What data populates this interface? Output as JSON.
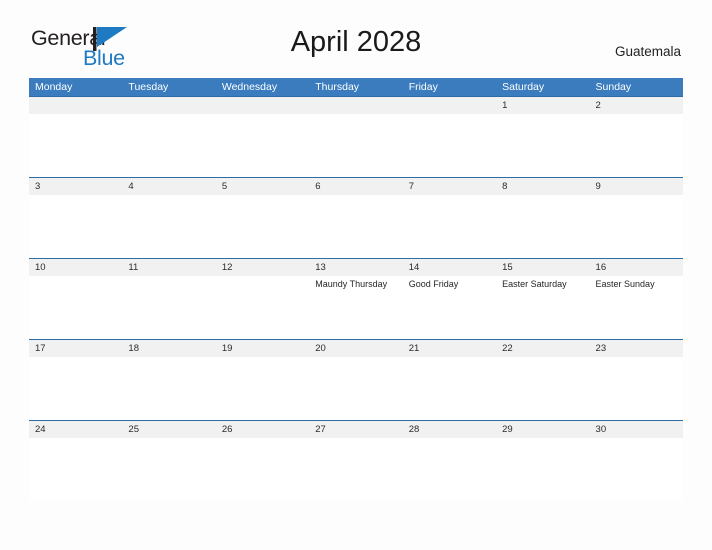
{
  "logo": {
    "word1": "General",
    "word2": "Blue",
    "flag_icon": "blue-flag-triangle-icon",
    "color_dark": "#231f20",
    "color_blue": "#1f7ac4"
  },
  "header": {
    "title": "April 2028",
    "country": "Guatemala"
  },
  "theme": {
    "header_bg": "#3a7cbe",
    "header_text": "#ffffff",
    "date_strip_bg": "#f1f1f1",
    "week_rule": "#2e6da4",
    "page_bg": "#fdfdfe"
  },
  "calendar": {
    "weekdays": [
      "Monday",
      "Tuesday",
      "Wednesday",
      "Thursday",
      "Friday",
      "Saturday",
      "Sunday"
    ],
    "weeks": [
      {
        "days": [
          {
            "num": "",
            "events": []
          },
          {
            "num": "",
            "events": []
          },
          {
            "num": "",
            "events": []
          },
          {
            "num": "",
            "events": []
          },
          {
            "num": "",
            "events": []
          },
          {
            "num": "1",
            "events": []
          },
          {
            "num": "2",
            "events": []
          }
        ]
      },
      {
        "days": [
          {
            "num": "3",
            "events": []
          },
          {
            "num": "4",
            "events": []
          },
          {
            "num": "5",
            "events": []
          },
          {
            "num": "6",
            "events": []
          },
          {
            "num": "7",
            "events": []
          },
          {
            "num": "8",
            "events": []
          },
          {
            "num": "9",
            "events": []
          }
        ]
      },
      {
        "days": [
          {
            "num": "10",
            "events": []
          },
          {
            "num": "11",
            "events": []
          },
          {
            "num": "12",
            "events": []
          },
          {
            "num": "13",
            "events": [
              "Maundy Thursday"
            ]
          },
          {
            "num": "14",
            "events": [
              "Good Friday"
            ]
          },
          {
            "num": "15",
            "events": [
              "Easter Saturday"
            ]
          },
          {
            "num": "16",
            "events": [
              "Easter Sunday"
            ]
          }
        ]
      },
      {
        "days": [
          {
            "num": "17",
            "events": []
          },
          {
            "num": "18",
            "events": []
          },
          {
            "num": "19",
            "events": []
          },
          {
            "num": "20",
            "events": []
          },
          {
            "num": "21",
            "events": []
          },
          {
            "num": "22",
            "events": []
          },
          {
            "num": "23",
            "events": []
          }
        ]
      },
      {
        "days": [
          {
            "num": "24",
            "events": []
          },
          {
            "num": "25",
            "events": []
          },
          {
            "num": "26",
            "events": []
          },
          {
            "num": "27",
            "events": []
          },
          {
            "num": "28",
            "events": []
          },
          {
            "num": "29",
            "events": []
          },
          {
            "num": "30",
            "events": []
          }
        ]
      }
    ]
  }
}
